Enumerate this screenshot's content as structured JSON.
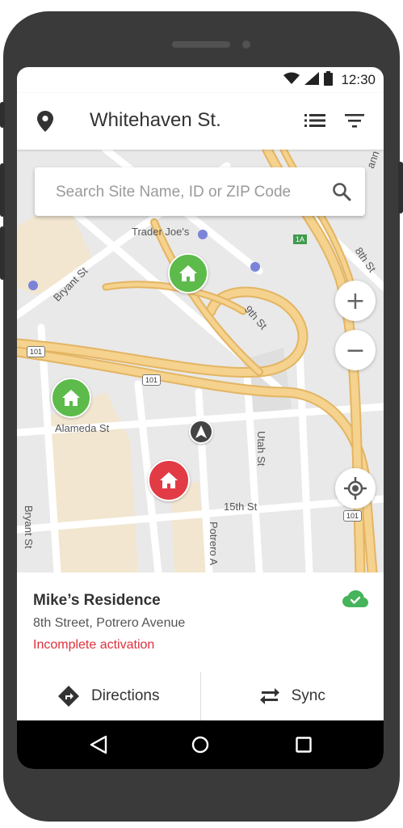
{
  "status_bar": {
    "time": "12:30",
    "icons": [
      "wifi-icon",
      "signal-icon",
      "battery-icon"
    ]
  },
  "header": {
    "title": "Whitehaven St.",
    "icons": [
      "location-pin-icon",
      "list-view-icon",
      "filter-icon"
    ]
  },
  "search": {
    "placeholder": "Search Site Name, ID or ZIP Code",
    "value": ""
  },
  "map": {
    "labels": {
      "trader_joes": "Trader Joe's",
      "bryant_st_1": "Bryant St",
      "bryant_st_2": "Bryant St",
      "ninth_st": "9th St",
      "eighth_st": "8th St",
      "alameda_st": "Alameda St",
      "utah_st": "Utah St",
      "fifteenth_st": "15th St",
      "potrero_a": "Potrero A",
      "hannah": "ann"
    },
    "shields": {
      "us101_a": "101",
      "us101_b": "101",
      "us101_c": "101",
      "hwy_1a": "1A"
    },
    "markers": [
      {
        "name": "site-marker-green-1",
        "status": "active",
        "color": "#5cbb4a"
      },
      {
        "name": "site-marker-green-2",
        "status": "active",
        "color": "#5cbb4a"
      },
      {
        "name": "site-marker-red",
        "status": "incomplete",
        "color": "#e23b45"
      }
    ],
    "controls": {
      "zoom_in": "+",
      "zoom_out": "−"
    }
  },
  "site_card": {
    "name": "Mike’s Residence",
    "address": "8th Street, Potrero Avenue",
    "status": "Incomplete activation",
    "status_color": "#e0303c",
    "sync_status_color": "#47b35a"
  },
  "actions": {
    "directions": "Directions",
    "sync": "Sync"
  },
  "colors": {
    "accent_green": "#5cbb4a",
    "alert_red": "#e23b45",
    "road_major": "#f5d28d",
    "road_major_stroke": "#e3b563",
    "block": "#f2e6d0"
  }
}
